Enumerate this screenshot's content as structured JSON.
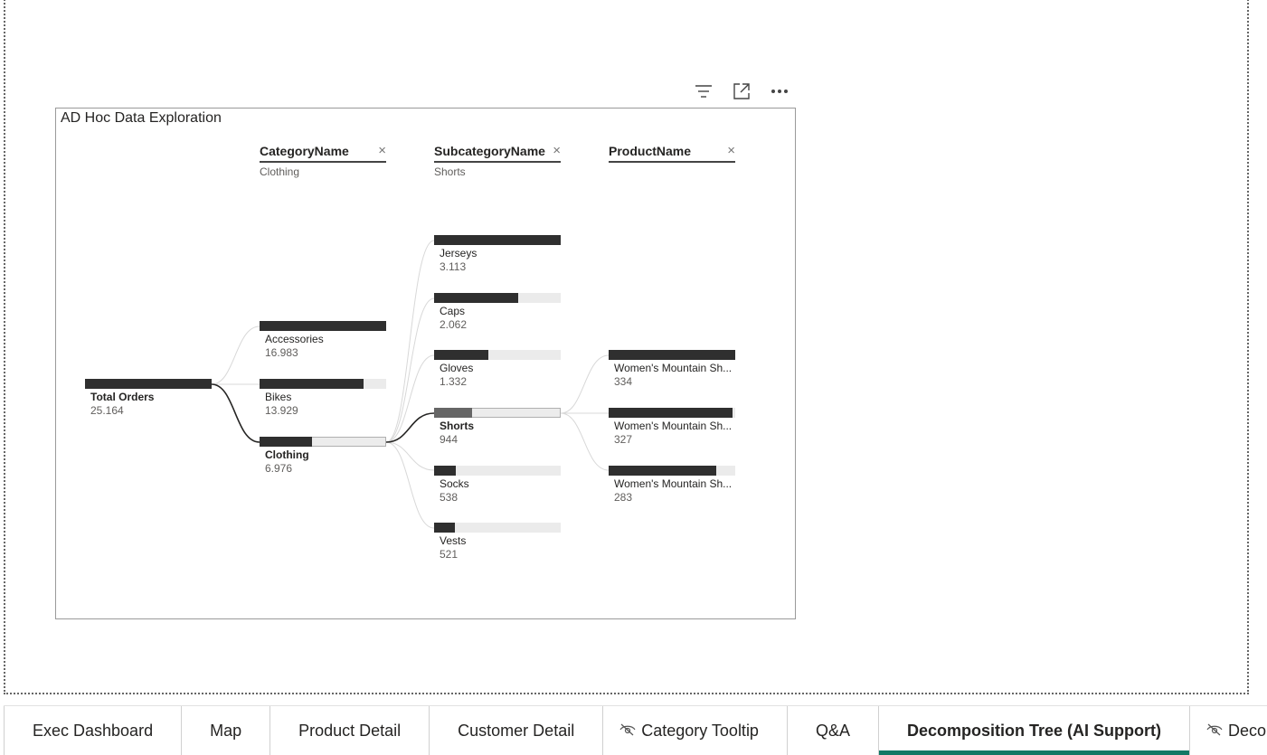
{
  "visual": {
    "title": "AD Hoc Data Exploration",
    "toolbar": {
      "filter_icon": "filter-icon",
      "focus_icon": "focus-mode-icon",
      "more_icon": "more-options-icon"
    }
  },
  "levels": [
    {
      "header": "CategoryName",
      "selection": "Clothing",
      "close": "×"
    },
    {
      "header": "SubcategoryName",
      "selection": "Shorts",
      "close": "×"
    },
    {
      "header": "ProductName",
      "selection": "",
      "close": "×"
    }
  ],
  "tree": {
    "root": {
      "name": "Total Orders",
      "value": "25.164"
    },
    "categories": [
      {
        "name": "Accessories",
        "value": "16.983"
      },
      {
        "name": "Bikes",
        "value": "13.929"
      },
      {
        "name": "Clothing",
        "value": "6.976"
      }
    ],
    "subcategories": [
      {
        "name": "Jerseys",
        "value": "3.113"
      },
      {
        "name": "Caps",
        "value": "2.062"
      },
      {
        "name": "Gloves",
        "value": "1.332"
      },
      {
        "name": "Shorts",
        "value": "944"
      },
      {
        "name": "Socks",
        "value": "538"
      },
      {
        "name": "Vests",
        "value": "521"
      }
    ],
    "products": [
      {
        "name": "Women's Mountain Sh...",
        "value": "334"
      },
      {
        "name": "Women's Mountain Sh...",
        "value": "327"
      },
      {
        "name": "Women's Mountain Sh...",
        "value": "283"
      }
    ]
  },
  "tabs": [
    {
      "label": "Exec Dashboard",
      "hidden": false,
      "active": false
    },
    {
      "label": "Map",
      "hidden": false,
      "active": false
    },
    {
      "label": "Product Detail",
      "hidden": false,
      "active": false
    },
    {
      "label": "Customer Detail",
      "hidden": false,
      "active": false
    },
    {
      "label": "Category Tooltip",
      "hidden": true,
      "active": false
    },
    {
      "label": "Q&A",
      "hidden": false,
      "active": false
    },
    {
      "label": "Decomposition Tree (AI Support)",
      "hidden": false,
      "active": true
    },
    {
      "label": "Decompos",
      "hidden": true,
      "active": false
    }
  ],
  "colors": {
    "bar": "#2f2f2f",
    "track": "#ebebeb",
    "accent": "#117865"
  }
}
